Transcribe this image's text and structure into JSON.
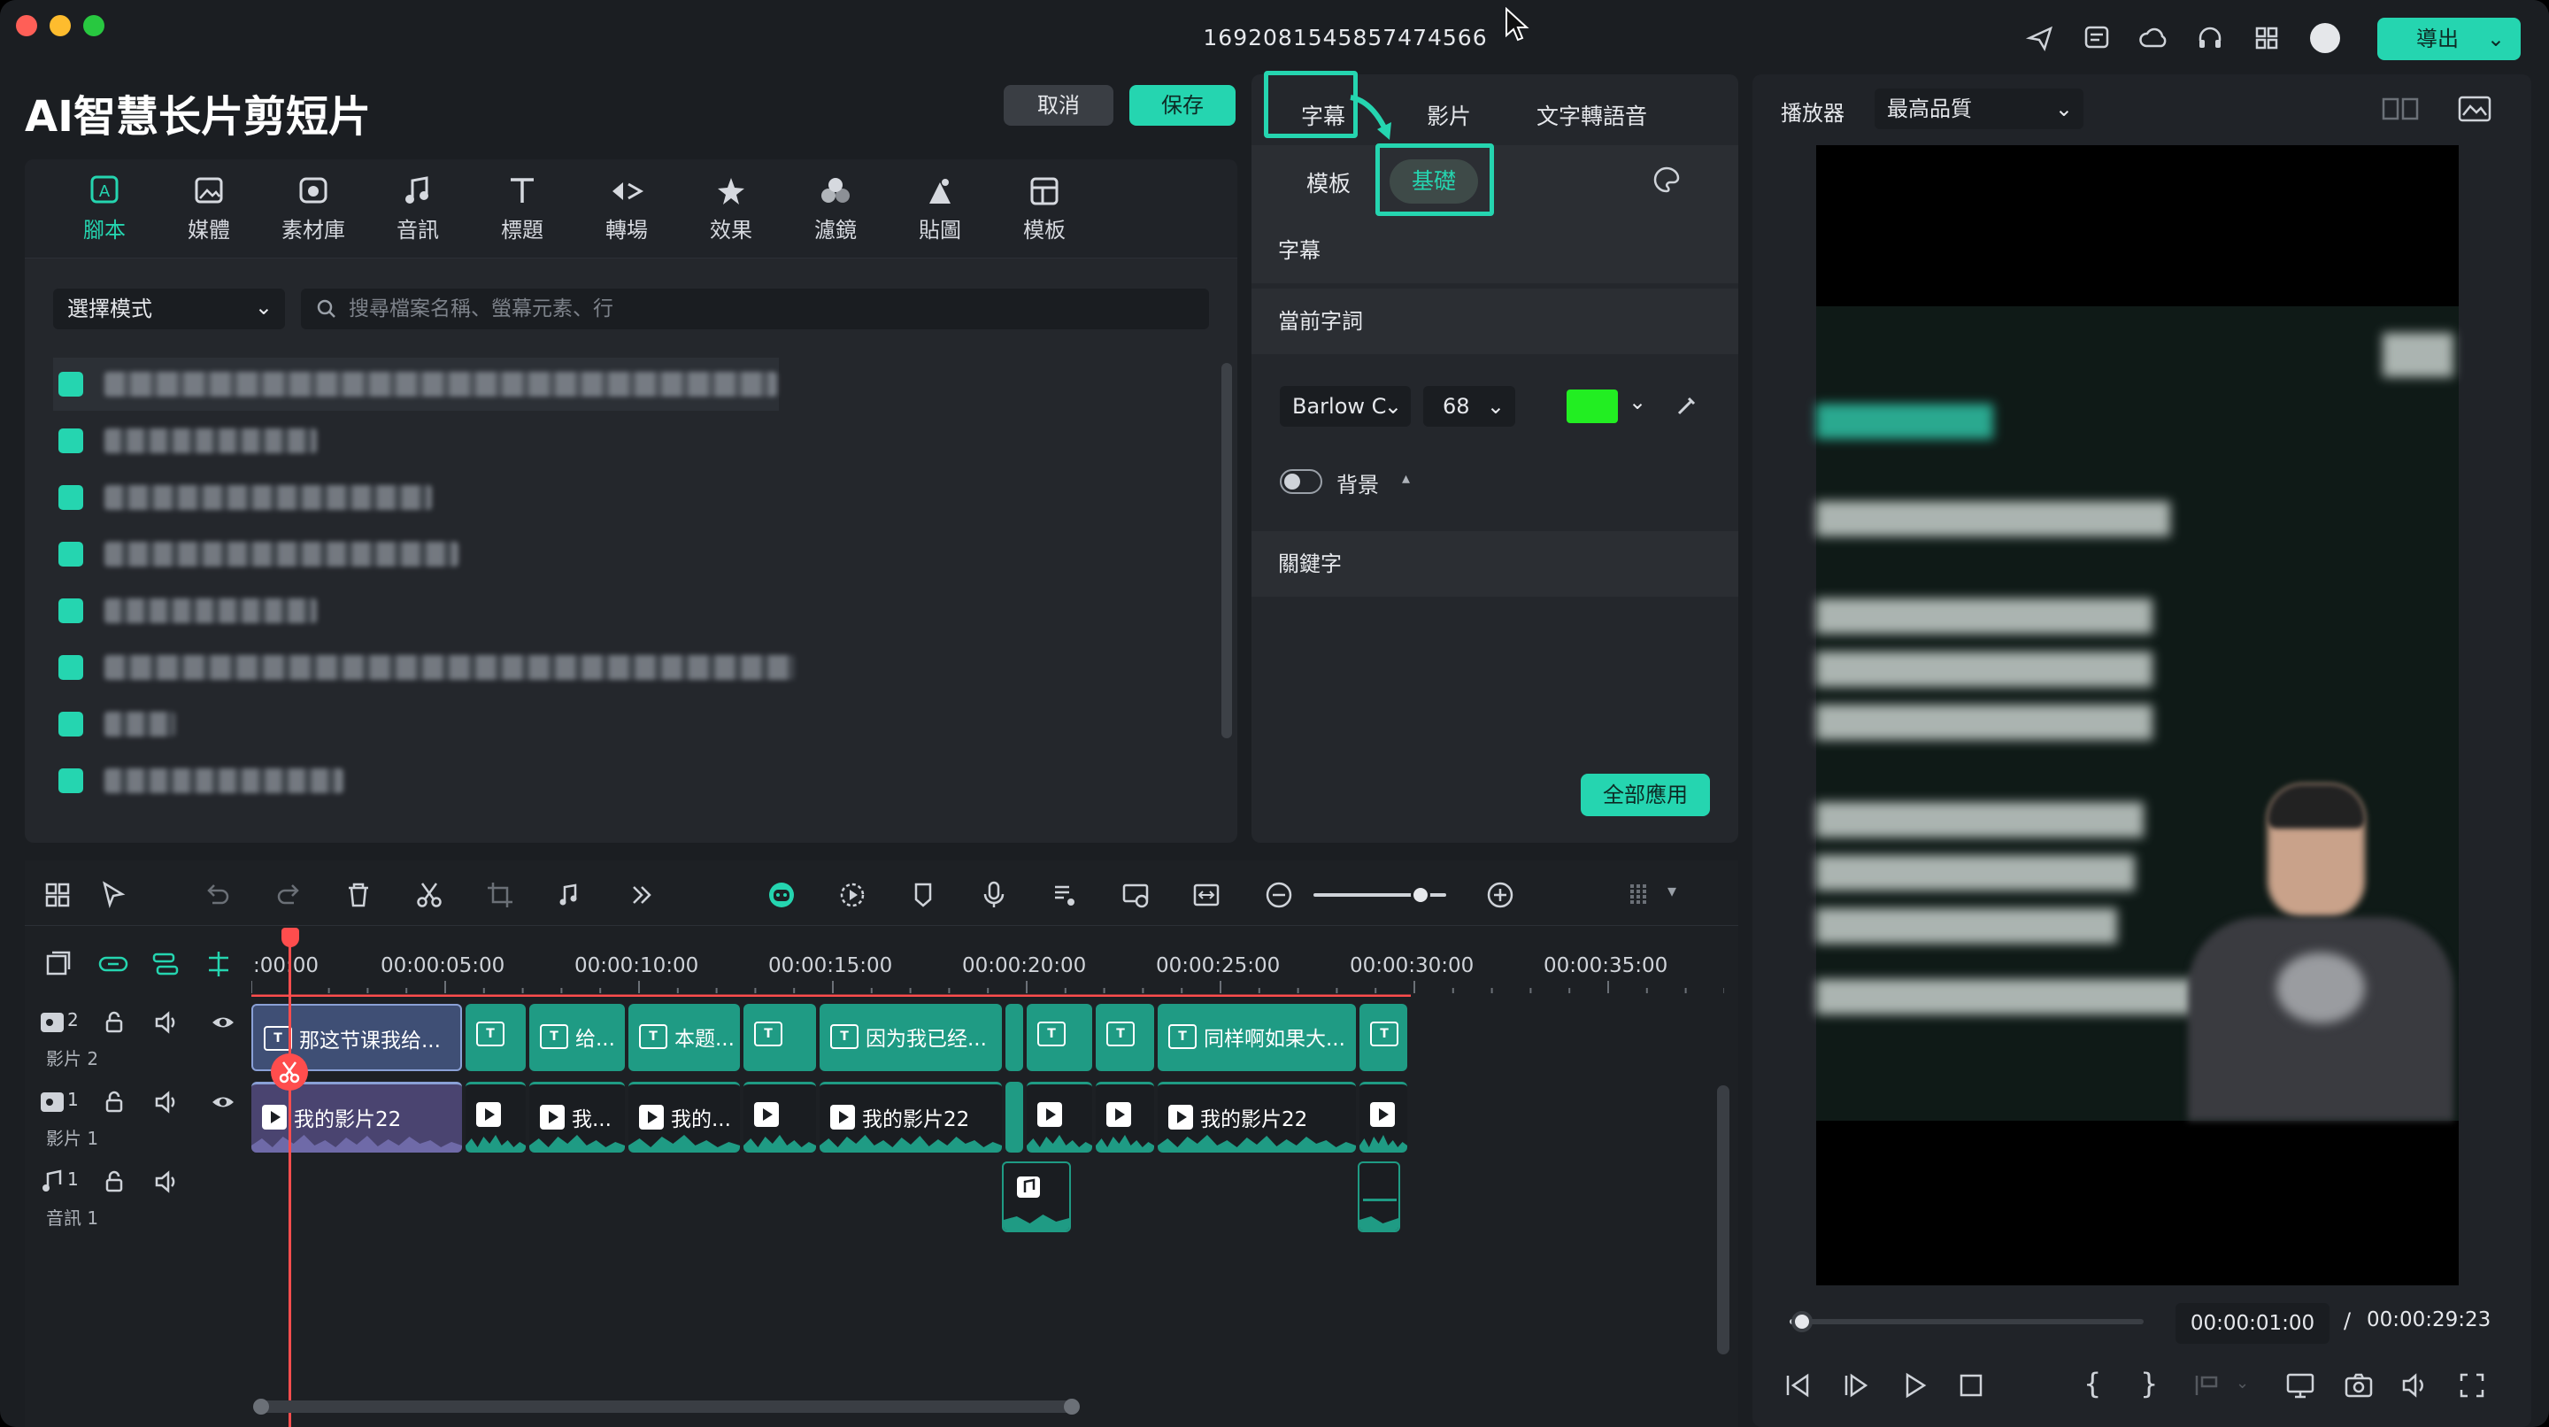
{
  "window": {
    "title": "1692081545857474566",
    "export_label": "導出"
  },
  "editor": {
    "title": "AI智慧长片剪短片",
    "cancel_label": "取消",
    "save_label": "保存"
  },
  "toolbar": {
    "items": [
      {
        "label": "腳本",
        "icon": "script-icon"
      },
      {
        "label": "媒體",
        "icon": "media-icon"
      },
      {
        "label": "素材庫",
        "icon": "library-icon"
      },
      {
        "label": "音訊",
        "icon": "audio-icon"
      },
      {
        "label": "標題",
        "icon": "title-icon"
      },
      {
        "label": "轉場",
        "icon": "transition-icon"
      },
      {
        "label": "效果",
        "icon": "effects-icon"
      },
      {
        "label": "濾鏡",
        "icon": "filter-icon"
      },
      {
        "label": "貼圖",
        "icon": "sticker-icon"
      },
      {
        "label": "模板",
        "icon": "template-icon"
      }
    ]
  },
  "script": {
    "mode_select": "選擇模式",
    "search_placeholder": "搜尋檔案名稱、螢幕元素、行"
  },
  "caption_panel": {
    "tabs": [
      "字幕",
      "影片",
      "文字轉語音"
    ],
    "subtabs": [
      "模板",
      "基礎"
    ],
    "section_caption": "字幕",
    "section_current": "當前字詞",
    "font_name": "Barlow C",
    "font_size": "68",
    "color": "#22ee22",
    "background_label": "背景",
    "keyword_label": "關鍵字",
    "apply_all_label": "全部應用"
  },
  "timeline": {
    "ruler_labels": [
      ":00:00",
      "00:00:05:00",
      "00:00:10:00",
      "00:00:15:00",
      "00:00:20:00",
      "00:00:25:00",
      "00:00:30:00",
      "00:00:35:00"
    ],
    "tracks": [
      {
        "num": "2",
        "name": "影片 2"
      },
      {
        "num": "1",
        "name": "影片 1"
      },
      {
        "num": "1",
        "name": "音訊 1"
      }
    ],
    "title_clips": [
      "那这节课我给...",
      "",
      "给...",
      "本题...",
      "",
      "因为我已经...",
      "",
      "",
      "同样啊如果大...",
      ""
    ],
    "video_clips": [
      "我的影片22",
      "",
      "我...",
      "我的...",
      "",
      "我的影片22",
      "",
      "",
      "我的影片22",
      ""
    ]
  },
  "player": {
    "label": "播放器",
    "quality": "最高品質",
    "current_time": "00:00:01:00",
    "separator": "/",
    "total_time": "00:00:29:23"
  },
  "colors": {
    "accent": "#25d5b0",
    "playhead": "#ff4d4d"
  }
}
